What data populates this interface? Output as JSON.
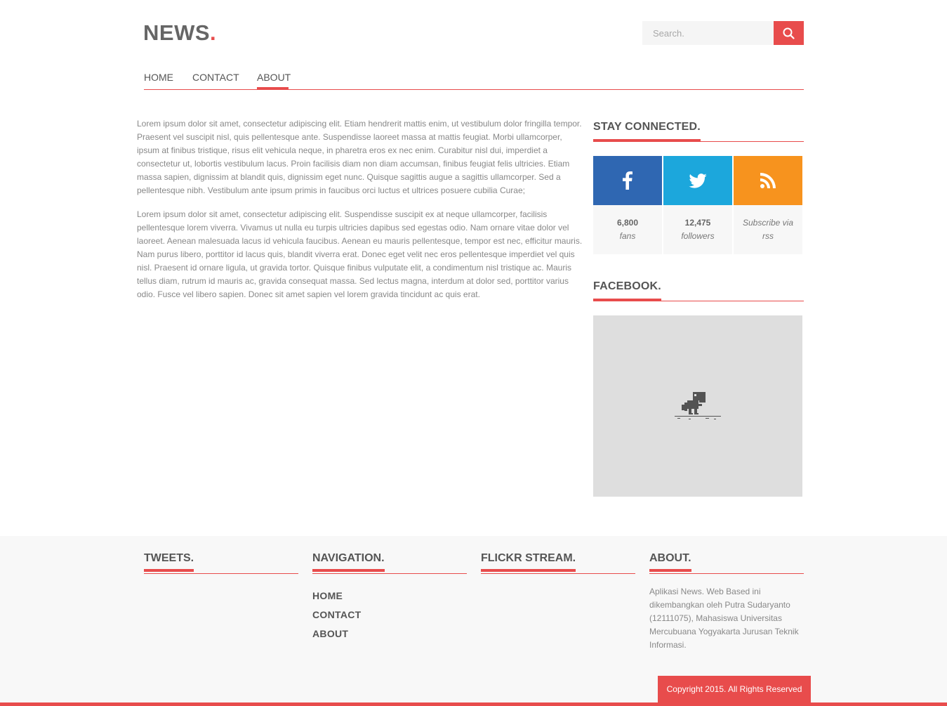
{
  "header": {
    "logo_text": "NEWS",
    "logo_dot": ".",
    "search_placeholder": "Search."
  },
  "nav": {
    "items": [
      {
        "label": "HOME"
      },
      {
        "label": "CONTACT"
      },
      {
        "label": "ABOUT"
      }
    ],
    "active": "ABOUT"
  },
  "content": {
    "paragraphs": [
      "Lorem ipsum dolor sit amet, consectetur adipiscing elit. Etiam hendrerit mattis enim, ut vestibulum dolor fringilla tempor. Praesent vel suscipit nisl, quis pellentesque ante. Suspendisse laoreet massa at mattis feugiat. Morbi ullamcorper, ipsum at finibus tristique, risus elit vehicula neque, in pharetra eros ex nec enim. Curabitur nisl dui, imperdiet a consectetur ut, lobortis vestibulum lacus. Proin facilisis diam non diam accumsan, finibus feugiat felis ultricies. Etiam massa sapien, dignissim at blandit quis, dignissim eget nunc. Quisque sagittis augue a sagittis ullamcorper. Sed a pellentesque nibh. Vestibulum ante ipsum primis in faucibus orci luctus et ultrices posuere cubilia Curae;",
      "Lorem ipsum dolor sit amet, consectetur adipiscing elit. Suspendisse suscipit ex at neque ullamcorper, facilisis pellentesque lorem viverra. Vivamus ut nulla eu turpis ultricies dapibus sed egestas odio. Nam ornare vitae dolor vel laoreet. Aenean malesuada lacus id vehicula faucibus. Aenean eu mauris pellentesque, tempor est nec, efficitur mauris. Nam purus libero, porttitor id lacus quis, blandit viverra erat. Donec eget velit nec eros pellentesque imperdiet vel quis nisl. Praesent id ornare ligula, ut gravida tortor. Quisque finibus vulputate elit, a condimentum nisl tristique ac. Mauris tellus diam, rutrum id mauris ac, gravida consequat massa. Sed lectus magna, interdum at dolor sed, porttitor varius odio. Fusce vel libero sapien. Donec sit amet sapien vel lorem gravida tincidunt ac quis erat."
    ]
  },
  "sidebar": {
    "stay_connected_title": "STAY CONNECTED.",
    "social": [
      {
        "icon": "facebook-icon",
        "color": "#2f67b2",
        "count": "6,800",
        "unit": "fans"
      },
      {
        "icon": "twitter-icon",
        "color": "#1ca7dc",
        "count": "12,475",
        "unit": "followers"
      },
      {
        "icon": "rss-icon",
        "color": "#f7931e",
        "count": "",
        "unit": "Subscribe via rss"
      }
    ],
    "facebook_title": "FACEBOOK."
  },
  "footer": {
    "tweets_title": "TWEETS.",
    "navigation_title": "NAVIGATION.",
    "nav_items": [
      "HOME",
      "CONTACT",
      "ABOUT"
    ],
    "flickr_title": "FLICKR STREAM.",
    "about_title": "ABOUT.",
    "about_text": "Aplikasi News. Web Based ini dikembangkan oleh Putra Sudaryanto (12111075), Mahasiswa Universitas Mercubuana Yogyakarta Jurusan Teknik Informasi.",
    "copyright": "Copyright 2015. All Rights Reserved"
  },
  "colors": {
    "accent": "#e84c4c",
    "facebook": "#2f67b2",
    "twitter": "#1ca7dc",
    "rss": "#f7931e"
  }
}
